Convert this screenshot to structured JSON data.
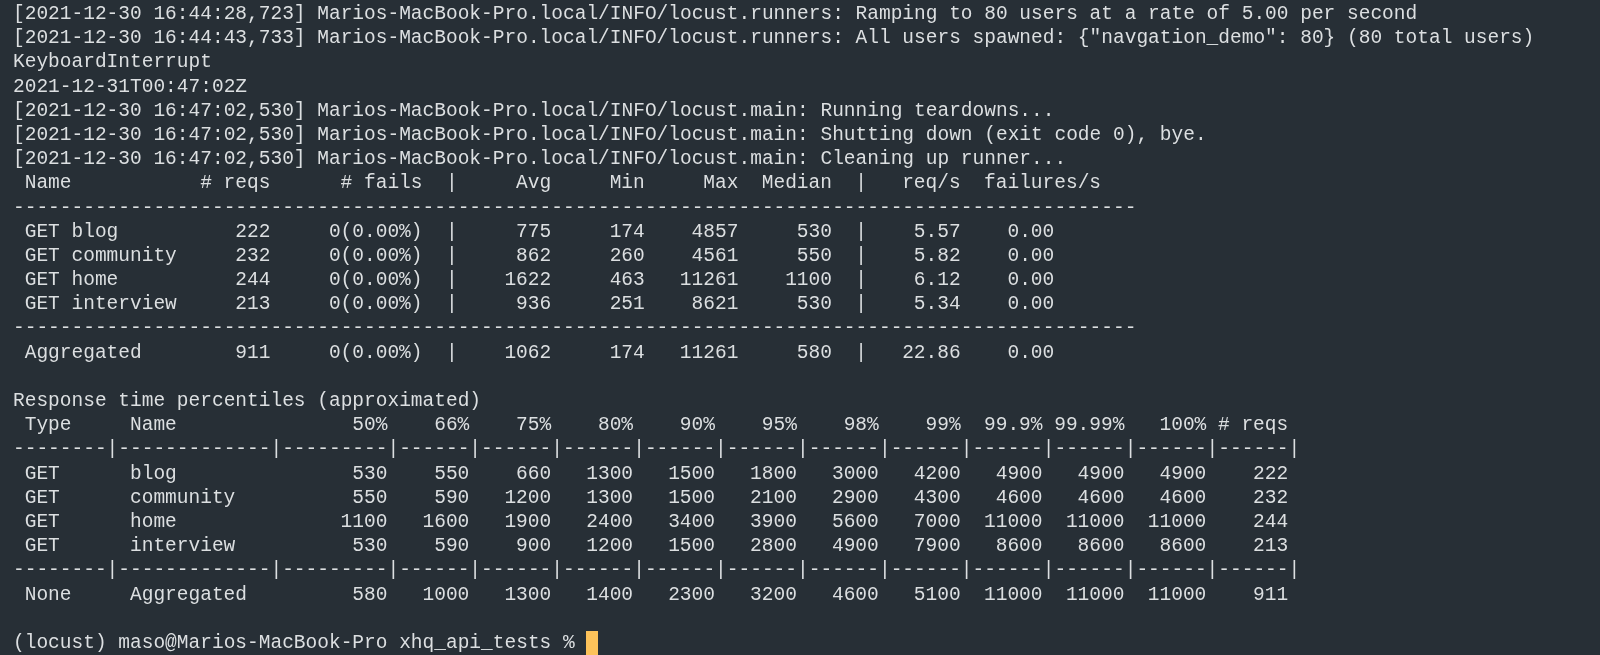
{
  "terminal": {
    "log_lines": [
      "[2021-12-30 16:44:28,723] Marios-MacBook-Pro.local/INFO/locust.runners: Ramping to 80 users at a rate of 5.00 per second",
      "[2021-12-30 16:44:43,733] Marios-MacBook-Pro.local/INFO/locust.runners: All users spawned: {\"navgation_demo\": 80} (80 total users)",
      "KeyboardInterrupt",
      "2021-12-31T00:47:02Z",
      "[2021-12-30 16:47:02,530] Marios-MacBook-Pro.local/INFO/locust.main: Running teardowns...",
      "[2021-12-30 16:47:02,530] Marios-MacBook-Pro.local/INFO/locust.main: Shutting down (exit code 0), bye.",
      "[2021-12-30 16:47:02,530] Marios-MacBook-Pro.local/INFO/locust.main: Cleaning up runner..."
    ],
    "stats_table": {
      "columns": [
        "Name",
        "# reqs",
        "# fails",
        "Avg",
        "Min",
        "Max",
        "Median",
        "req/s",
        "failures/s"
      ],
      "divider": "|",
      "rule": "------------------------------------------------------------------------------------------------",
      "rows": [
        [
          "GET blog",
          "222",
          "0(0.00%)",
          "775",
          "174",
          "4857",
          "530",
          "5.57",
          "0.00"
        ],
        [
          "GET community",
          "232",
          "0(0.00%)",
          "862",
          "260",
          "4561",
          "550",
          "5.82",
          "0.00"
        ],
        [
          "GET home",
          "244",
          "0(0.00%)",
          "1622",
          "463",
          "11261",
          "1100",
          "6.12",
          "0.00"
        ],
        [
          "GET interview",
          "213",
          "0(0.00%)",
          "936",
          "251",
          "8621",
          "530",
          "5.34",
          "0.00"
        ]
      ],
      "total": [
        "Aggregated",
        "911",
        "0(0.00%)",
        "1062",
        "174",
        "11261",
        "580",
        "22.86",
        "0.00"
      ]
    },
    "percentiles_title": "Response time percentiles (approximated)",
    "percentile_table": {
      "columns": [
        "Type",
        "Name",
        "50%",
        "66%",
        "75%",
        "80%",
        "90%",
        "95%",
        "98%",
        "99%",
        "99.9%",
        "99.99%",
        "100%",
        "# reqs"
      ],
      "rule": "--------|-------------|---------|------|------|------|------|------|------|------|------|------|------|------|",
      "rows": [
        [
          "GET",
          "blog",
          "530",
          "550",
          "660",
          "1300",
          "1500",
          "1800",
          "3000",
          "4200",
          "4900",
          "4900",
          "4900",
          "222"
        ],
        [
          "GET",
          "community",
          "550",
          "590",
          "1200",
          "1300",
          "1500",
          "2100",
          "2900",
          "4300",
          "4600",
          "4600",
          "4600",
          "232"
        ],
        [
          "GET",
          "home",
          "1100",
          "1600",
          "1900",
          "2400",
          "3400",
          "3900",
          "5600",
          "7000",
          "11000",
          "11000",
          "11000",
          "244"
        ],
        [
          "GET",
          "interview",
          "530",
          "590",
          "900",
          "1200",
          "1500",
          "2800",
          "4900",
          "7900",
          "8600",
          "8600",
          "8600",
          "213"
        ]
      ],
      "total": [
        "None",
        "Aggregated",
        "580",
        "1000",
        "1300",
        "1400",
        "2300",
        "3200",
        "4600",
        "5100",
        "11000",
        "11000",
        "11000",
        "911"
      ]
    },
    "prompt": "(locust) maso@Marios-MacBook-Pro xhq_api_tests %"
  }
}
